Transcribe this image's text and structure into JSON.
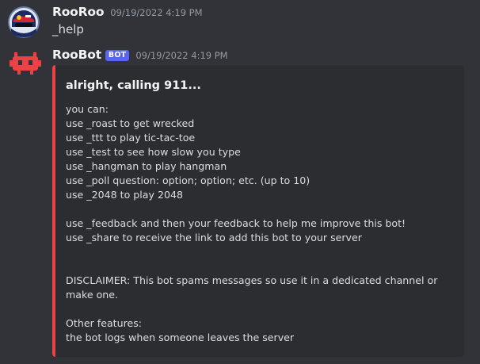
{
  "messages": [
    {
      "author": "RooRoo",
      "timestamp": "09/19/2022 4:19 PM",
      "avatar_icon": "user-avatar-icon",
      "text": "_help"
    },
    {
      "author": "RooBot",
      "bot_tag": "BOT",
      "timestamp": "09/19/2022 4:19 PM",
      "avatar_icon": "roobot-avatar-icon",
      "embed": {
        "accent_color": "#ed4245",
        "title": "alright, calling 911...",
        "lines": [
          "you can:",
          "use _roast to get wrecked",
          "use _ttt to play tic-tac-toe",
          "use _test to see how slow you type",
          "use _hangman to play hangman",
          "use _poll question: option; option; etc. (up to 10)",
          "use _2048 to play 2048",
          "",
          "use _feedback and then your feedback to help me improve this bot!",
          "use _share to receive the link to add this bot to your server",
          "",
          "",
          "DISCLAIMER: This bot spams messages so use it in a dedicated channel or make one.",
          "",
          "Other features:",
          "the bot logs when someone leaves the server"
        ]
      }
    }
  ],
  "colors": {
    "background": "#313338",
    "embed_background": "#2b2d31",
    "bot_tag": "#5865f2",
    "bot_avatar": "#ed4245"
  }
}
